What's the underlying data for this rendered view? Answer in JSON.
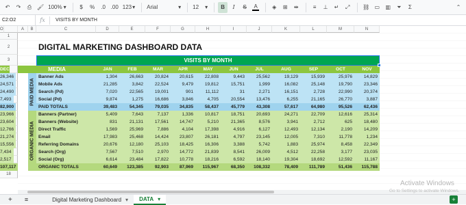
{
  "toolbar": {
    "undo_icon": "undo-icon",
    "redo_icon": "redo-icon",
    "print_icon": "print-icon",
    "paint_icon": "paint-format-icon",
    "zoom": "100%",
    "currency": "$",
    "percent": "%",
    "decimal_decrease": ".0",
    "decimal_increase": ".00",
    "more_formats": "123",
    "font": "Arial",
    "font_size": "12",
    "bold": "B",
    "italic": "I",
    "strike": "S",
    "text_color": "A"
  },
  "formula_bar": {
    "name_box": "C2:O2",
    "fx": "fx",
    "content": "VISITS BY MONTH"
  },
  "columns": [
    "A",
    "B",
    "C",
    "D",
    "E",
    "F",
    "G",
    "H",
    "I",
    "J",
    "K",
    "L",
    "M",
    "N",
    "O"
  ],
  "rows": [
    "1",
    "2",
    "3",
    "4",
    "5",
    "6",
    "7",
    "8",
    "9",
    "10",
    "11",
    "12",
    "13",
    "14",
    "15",
    "16",
    "17",
    "18"
  ],
  "sheet": {
    "title": "DIGITAL MARKETING DASHBOARD DATA",
    "banner": "VISITS BY MONTH",
    "media_header": "MEDIA",
    "months": [
      "JAN",
      "FEB",
      "MAR",
      "APR",
      "MAY",
      "JUN",
      "JUL",
      "AUG",
      "SEP",
      "OCT",
      "NOV",
      "DEC"
    ],
    "paid_group_label": "PAID MEDIA",
    "organic_group_label": "ORGANIC MEDIA",
    "paid_rows": [
      {
        "name": "Banner Ads",
        "values": [
          "1,304",
          "26,663",
          "20,824",
          "20,615",
          "22,808",
          "9,443",
          "25,562",
          "19,129",
          "15,939",
          "25,976",
          "14,829",
          "26,346"
        ]
      },
      {
        "name": "Mobile Ads",
        "values": [
          "21,285",
          "3,842",
          "22,524",
          "9,479",
          "19,812",
          "15,751",
          "1,999",
          "16,082",
          "25,148",
          "19,790",
          "23,346",
          "24,571"
        ]
      },
      {
        "name": "Search (Pd)",
        "values": [
          "7,020",
          "22,565",
          "19,001",
          "901",
          "11,112",
          "31",
          "2,271",
          "16,151",
          "2,728",
          "22,990",
          "20,374",
          "24,490"
        ]
      },
      {
        "name": "Social (Pd)",
        "values": [
          "9,874",
          "1,275",
          "16,686",
          "3,846",
          "4,705",
          "20,554",
          "13,476",
          "6,255",
          "21,165",
          "26,770",
          "3,887",
          "7,493"
        ]
      }
    ],
    "paid_total": {
      "name": "PAID TOTALS",
      "values": [
        "39,483",
        "54,345",
        "79,035",
        "34,835",
        "58,437",
        "45,779",
        "43,308",
        "57,617",
        "64,980",
        "95,526",
        "62,436",
        "82,900"
      ]
    },
    "organic_rows": [
      {
        "name": "Banners (Partner)",
        "values": [
          "5,409",
          "7,643",
          "7,137",
          "1,336",
          "10,817",
          "18,751",
          "20,693",
          "24,271",
          "22,709",
          "12,616",
          "25,314",
          "23,966"
        ]
      },
      {
        "name": "Banners (Website)",
        "values": [
          "831",
          "21,131",
          "17,561",
          "14,747",
          "5,210",
          "21,365",
          "8,576",
          "3,941",
          "2,712",
          "625",
          "18,480",
          "23,604"
        ]
      },
      {
        "name": "Direct Traffic",
        "values": [
          "1,569",
          "25,969",
          "7,886",
          "4,104",
          "17,398",
          "4,916",
          "6,127",
          "12,493",
          "12,134",
          "2,190",
          "14,209",
          "12,766"
        ]
      },
      {
        "name": "Email",
        "values": [
          "17,983",
          "25,468",
          "14,424",
          "23,807",
          "26,181",
          "4,797",
          "23,145",
          "12,005",
          "7,310",
          "11,778",
          "1,234",
          "21,274"
        ]
      },
      {
        "name": "Referring Domains",
        "values": [
          "20,676",
          "12,180",
          "25,103",
          "18,425",
          "16,306",
          "3,388",
          "5,742",
          "1,883",
          "25,974",
          "8,458",
          "22,349",
          "15,556"
        ]
      },
      {
        "name": "Search (Org)",
        "values": [
          "7,567",
          "7,510",
          "2,970",
          "14,772",
          "21,839",
          "8,541",
          "26,009",
          "4,512",
          "22,258",
          "3,177",
          "23,035",
          "7,434"
        ]
      },
      {
        "name": "Social (Org)",
        "values": [
          "6,614",
          "23,484",
          "17,822",
          "10,778",
          "18,216",
          "6,592",
          "18,140",
          "19,304",
          "18,692",
          "12,592",
          "11,167",
          "2,517"
        ]
      }
    ],
    "organic_total": {
      "name": "ORGANIC TOTALS",
      "values": [
        "60,649",
        "123,385",
        "92,903",
        "87,969",
        "115,967",
        "68,350",
        "108,332",
        "78,409",
        "111,789",
        "51,436",
        "115,788",
        "107,117"
      ]
    }
  },
  "sheets_bar": {
    "add_icon": "plus-icon",
    "list_icon": "sheet-list-icon",
    "tabs": [
      {
        "label": "Digital Marketing Dashboard"
      },
      {
        "label": "DATA"
      }
    ],
    "explore_icon": "explore-icon"
  },
  "watermark": {
    "line1": "Activate Windows",
    "line2": "Go to Settings to activate Windows."
  },
  "colors": {
    "title_green": "#00a651",
    "header_green": "#8dc63f",
    "paid_blue": "#bde3f5",
    "paid_total_blue": "#9fd3ee",
    "organic_green": "#cde7a8",
    "organic_total_green": "#b4d97e"
  }
}
